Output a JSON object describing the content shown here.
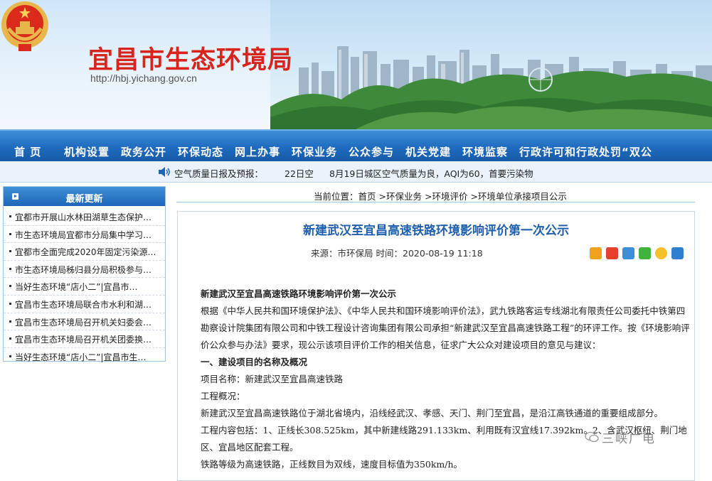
{
  "header": {
    "title": "宜昌市生态环境局",
    "url": "http://hbj.yichang.gov.cn"
  },
  "nav": {
    "items": [
      "首 页",
      "机构设置",
      "政务公开",
      "环保动态",
      "网上办事",
      "环保业务",
      "公众参与",
      "机关党建",
      "环境监察",
      "行政许可和行政处罚“双公"
    ]
  },
  "ticker": {
    "label": "空气质量日报及预报：",
    "date": "22日空",
    "message": "8月19日城区空气质量为良，AQI为60，首要污染物"
  },
  "sidebar": {
    "title": "最新更新",
    "items": [
      "宜都市开展山水林田湖草生态保护…",
      "市生态环境局宜都市分局集中学习…",
      "宜都市全面完成2020年固定污染源…",
      "市生态环境局秭归县分局积极参与…",
      "当好生态环境“店小二”|宜昌市…",
      "宜昌市生态环境局联合市水利和湖…",
      "宜昌市生态环境局召开机关妇委会…",
      "宜昌市生态环境局召开机关团委换…",
      "当好生态环境“店小二”|宜昌市生…"
    ]
  },
  "breadcrumb": {
    "prefix": "当前位置：",
    "home": "首页",
    "sep1": " >",
    "l1": "环保业务",
    "sep2": " >",
    "l2": "环境评价",
    "sep3": " >",
    "l3": "环境单位承接项目公示"
  },
  "article": {
    "title": "新建武汉至宜昌高速铁路环境影响评价第一次公示",
    "source_label": "来源：",
    "source": "市环保局",
    "time_label": "时间：",
    "time": "2020-08-19 11:18",
    "paragraphs": [
      "新建武汉至宜昌高速铁路环境影响评价第一次公示",
      "根据《中华人民共和国环境保护法》、《中华人民共和国环境影响评价法》，武九铁路客运专线湖北有限责任公司委托中铁第四勘察设计院集团有限公司和中铁工程设计咨询集团有限公司承担“新建武汉至宜昌高速铁路工程”的环评工作。按《环境影响评价公众参与办法》要求，现公示该项目评价工作的相关信息，征求广大公众对建设项目的意见与建议：",
      "一、建设项目的名称及概况",
      "项目名称：新建武汉至宜昌高速铁路",
      "工程概况：",
      "新建武汉至宜昌高速铁路位于湖北省境内，沿线经武汉、孝感、天门、荆门至宜昌，是沿江高铁通道的重要组成部分。",
      "工程内容包括：1、正线长308.525km，其中新建线路291.133km、利用既有汉宜线17.392km。2、含武汉枢纽、荆门地区、宜昌地区配套工程。",
      "铁路等级为高速铁路，正线数目为双线，速度目标值为350km/h。"
    ]
  },
  "watermark": {
    "text": "三峡广电"
  },
  "colors": {
    "brand_red": "#d8241c",
    "nav_blue": "#1f6bbf",
    "title_blue": "#1e5fae"
  }
}
